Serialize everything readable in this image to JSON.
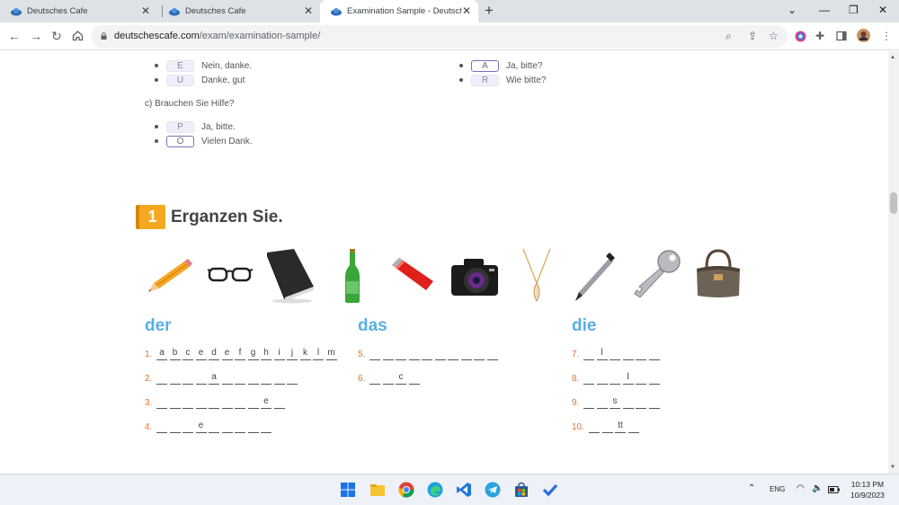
{
  "browser": {
    "tabs": [
      {
        "title": "Deutsches Cafe",
        "active": false
      },
      {
        "title": "Deutsches Cafe",
        "active": false
      },
      {
        "title": "Examination Sample - Deutsche",
        "active": true
      }
    ],
    "url_host": "deutschescafe.com",
    "url_path": "/exam/examination-sample/",
    "new_tab_label": "+"
  },
  "section_b": {
    "left_options": [
      {
        "letter": "E",
        "text": "Nein, danke.",
        "selected": false
      },
      {
        "letter": "U",
        "text": "Danke, gut",
        "selected": false
      }
    ],
    "right_options": [
      {
        "letter": "A",
        "text": "Ja, bitte?",
        "selected": true
      },
      {
        "letter": "R",
        "text": "Wie bitte?",
        "selected": false
      }
    ]
  },
  "section_c": {
    "question": "c) Brauchen Sie Hilfe?",
    "options": [
      {
        "letter": "P",
        "text": "Ja, bitte.",
        "selected": false
      },
      {
        "letter": "O",
        "text": "Vielen Dank.",
        "selected": true
      }
    ]
  },
  "exercise": {
    "number": "1",
    "title": "Erganzen Sie.",
    "pictures": [
      "pencil",
      "glasses",
      "book",
      "bottle",
      "lighter",
      "camera",
      "necklace",
      "pen",
      "key",
      "bag"
    ],
    "columns": [
      {
        "article": "der",
        "items": [
          {
            "num": "1.",
            "slots": [
              "a",
              "b",
              "c",
              "e",
              "d",
              "e",
              "f",
              "g",
              "h",
              "i",
              "j",
              "k",
              "l",
              "m"
            ]
          },
          {
            "num": "2.",
            "slots": [
              "",
              "",
              "",
              "",
              "a",
              "",
              "",
              "",
              "",
              "",
              ""
            ]
          },
          {
            "num": "3.",
            "slots": [
              "",
              "",
              "",
              "",
              "",
              "",
              "",
              "",
              "e",
              ""
            ]
          },
          {
            "num": "4.",
            "slots": [
              "",
              "",
              "",
              "e",
              "",
              "",
              "",
              "",
              ""
            ]
          }
        ]
      },
      {
        "article": "das",
        "items": [
          {
            "num": "5.",
            "slots": [
              "",
              "",
              "",
              "",
              "",
              "",
              "",
              "",
              "",
              ""
            ]
          },
          {
            "num": "6.",
            "slots": [
              "",
              "",
              "c",
              ""
            ]
          }
        ]
      },
      {
        "article": "die",
        "items": [
          {
            "num": "7.",
            "slots": [
              "",
              "l",
              "",
              "",
              "",
              ""
            ]
          },
          {
            "num": "8.",
            "slots": [
              "",
              "",
              "",
              "l",
              "",
              ""
            ]
          },
          {
            "num": "9.",
            "slots": [
              "",
              "",
              "s",
              "",
              "",
              ""
            ]
          },
          {
            "num": "10.",
            "slots": [
              "",
              "",
              "tt",
              ""
            ]
          }
        ]
      }
    ]
  },
  "taskbar": {
    "language": "ENG",
    "time": "10:13 PM",
    "date": "10/9/2023"
  }
}
